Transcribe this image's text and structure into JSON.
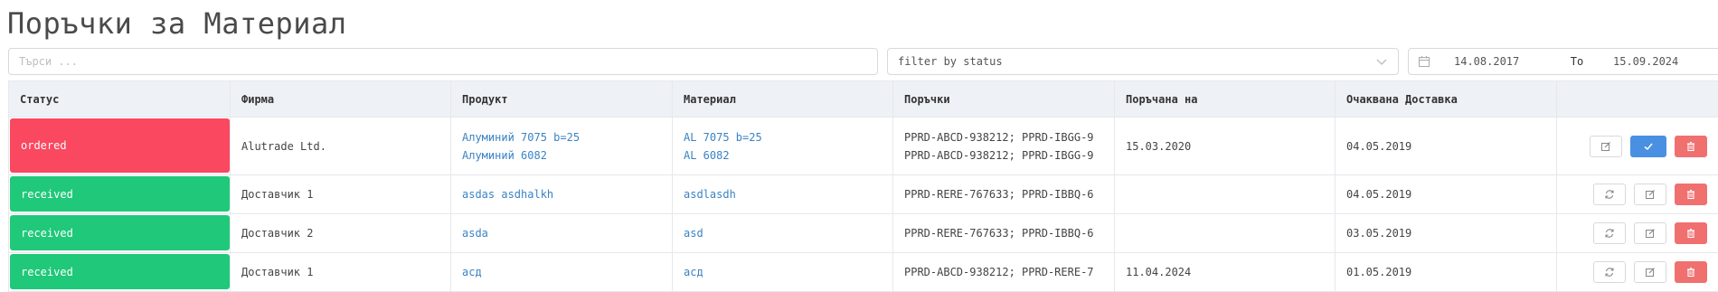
{
  "page": {
    "title": "Поръчки за Материал"
  },
  "filters": {
    "search_placeholder": "Търси ...",
    "status_placeholder": "filter by status",
    "date_from": "14.08.2017",
    "date_separator": "To",
    "date_to": "15.09.2024"
  },
  "colors": {
    "ordered": "#f9485f",
    "received": "#20c879",
    "link": "#3a83c4",
    "primary": "#4a90e2",
    "danger": "#f0706f",
    "header_bg": "#eef1f5"
  },
  "table": {
    "columns": [
      "Статус",
      "Фирма",
      "Продукт",
      "Материал",
      "Поръчки",
      "Поръчана на",
      "Очаквана Доставка",
      ""
    ],
    "rows": [
      {
        "status": "ordered",
        "firm": "Alutrade Ltd.",
        "products": [
          "Алуминий 7075 b=25",
          "Алуминий 6082"
        ],
        "materials": [
          "AL 7075 b=25",
          "AL 6082"
        ],
        "orders": [
          "PPRD-ABCD-938212; PPRD-IBGG-9",
          "PPRD-ABCD-938212; PPRD-IBGG-9"
        ],
        "ordered_on": "15.03.2020",
        "expected_delivery": "04.05.2019",
        "actions": [
          "edit-icon",
          "check-icon",
          "trash-icon"
        ]
      },
      {
        "status": "received",
        "firm": "Доставчик 1",
        "products": [
          "asdas asdhalkh"
        ],
        "materials": [
          "asdlasdh"
        ],
        "orders": [
          "PPRD-RERE-767633; PPRD-IBBQ-6"
        ],
        "ordered_on": "",
        "expected_delivery": "04.05.2019",
        "actions": [
          "refresh-icon",
          "edit-icon",
          "trash-icon"
        ]
      },
      {
        "status": "received",
        "firm": "Доставчик 2",
        "products": [
          "asda"
        ],
        "materials": [
          "asd"
        ],
        "orders": [
          "PPRD-RERE-767633; PPRD-IBBQ-6"
        ],
        "ordered_on": "",
        "expected_delivery": "03.05.2019",
        "actions": [
          "refresh-icon",
          "edit-icon",
          "trash-icon"
        ]
      },
      {
        "status": "received",
        "firm": "Доставчик 1",
        "products": [
          "асд"
        ],
        "materials": [
          "асд"
        ],
        "orders": [
          "PPRD-ABCD-938212; PPRD-RERE-7"
        ],
        "ordered_on": "11.04.2024",
        "expected_delivery": "01.05.2019",
        "actions": [
          "refresh-icon",
          "edit-icon",
          "trash-icon"
        ]
      }
    ]
  }
}
